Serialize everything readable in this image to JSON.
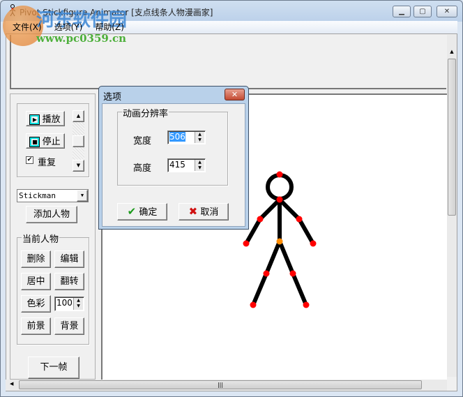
{
  "window": {
    "title": "Pivot Stickfigure Animator [支点线条人物漫画家]",
    "min": "▁",
    "max": "▢",
    "close": "✕"
  },
  "menu": [
    "文件(X)",
    "选项(Y)",
    "帮助(Z)"
  ],
  "watermark": {
    "name": "河东软件园",
    "url": "www.pc0359.cn"
  },
  "left_panel": {
    "play": "播放",
    "stop": "停止",
    "repeat_label": "重复",
    "repeat_checked": true,
    "figure_select": "Stickman",
    "add_figure": "添加人物",
    "current_group": "当前人物",
    "delete": "删除",
    "edit": "编辑",
    "center": "居中",
    "flip": "翻转",
    "color": "色彩",
    "opacity": "100",
    "front": "前景",
    "back": "背景",
    "next_frame": "下一帧"
  },
  "dialog": {
    "title": "选项",
    "group": "动画分辨率",
    "width_label": "宽度",
    "width_value": "506",
    "height_label": "高度",
    "height_value": "415",
    "ok": "确定",
    "cancel": "取消"
  },
  "colors": {
    "joint": "#ff0000",
    "center_joint": "#ff8c00",
    "selection": "#3399ff"
  }
}
